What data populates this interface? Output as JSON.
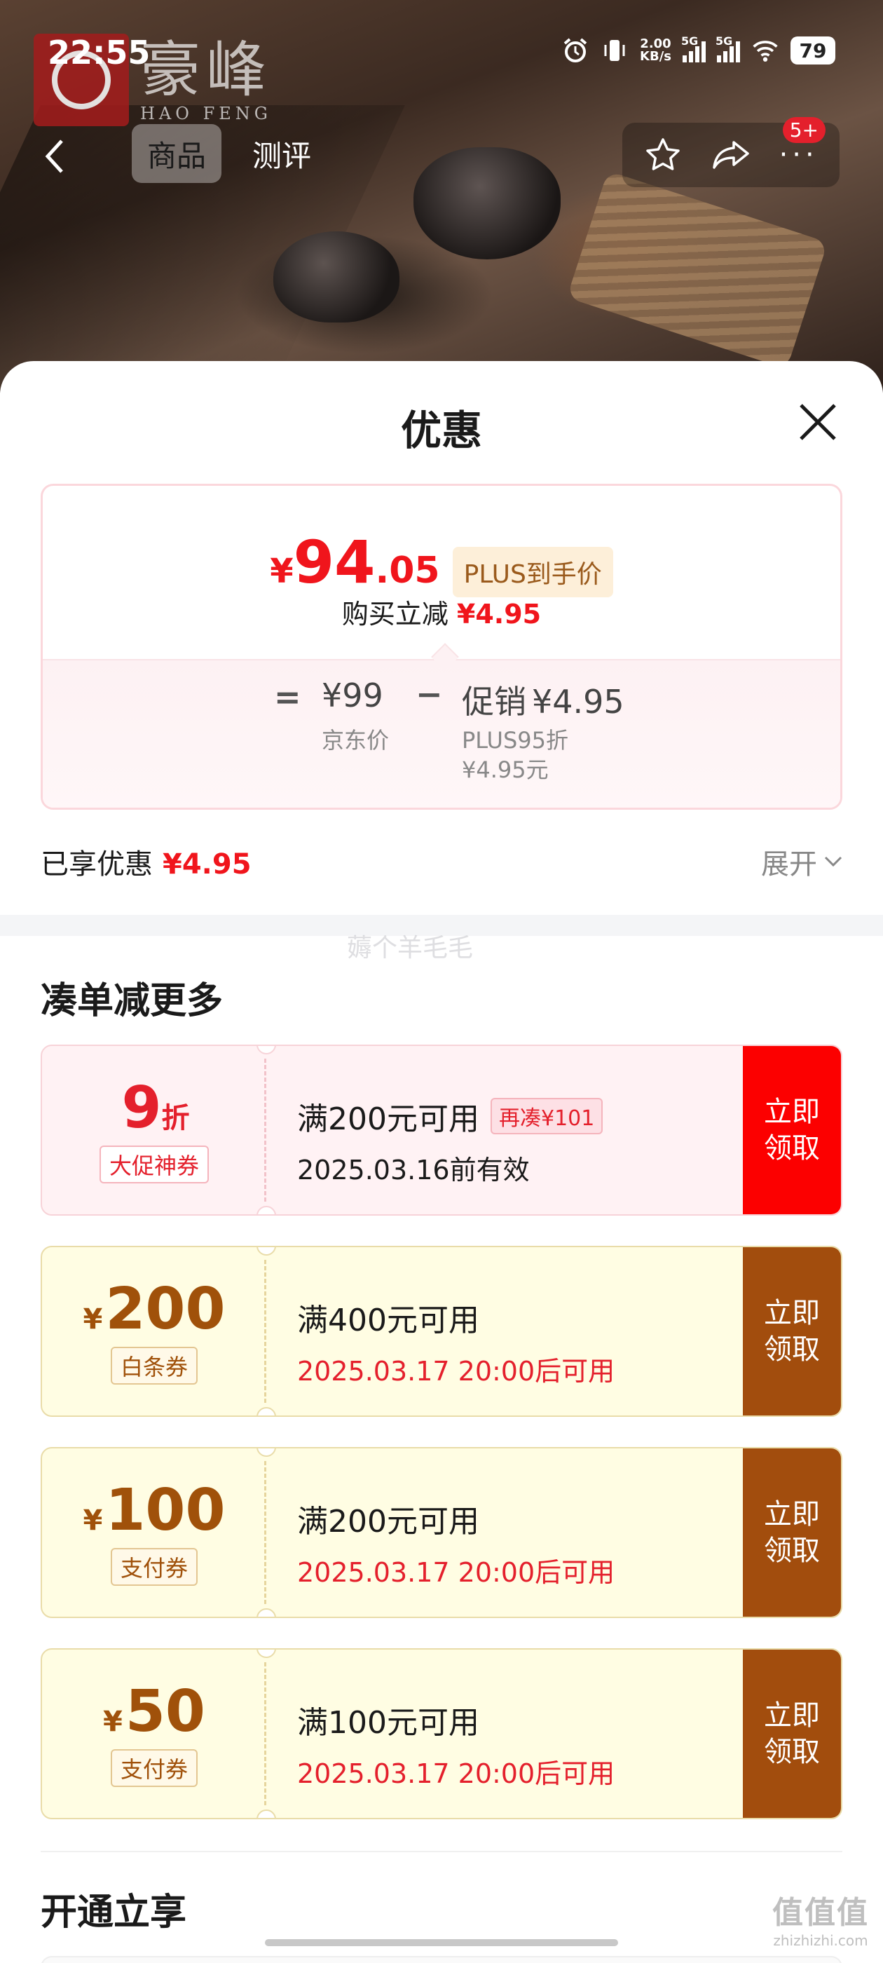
{
  "status_bar": {
    "time": "22:55",
    "net_speed_value": "2.00",
    "net_speed_unit": "KB/s",
    "signal1_tag": "5G",
    "signal2_tag": "5G",
    "battery": "79"
  },
  "brand": {
    "name": "豪峰",
    "pinyin": "HAO FENG"
  },
  "nav": {
    "tabs": [
      {
        "label": "商品",
        "active": true
      },
      {
        "label": "测评",
        "active": false
      }
    ],
    "message_badge": "5+"
  },
  "sheet": {
    "title": "优惠"
  },
  "price_card": {
    "yen": "¥",
    "price_int": "94",
    "price_dec": ".05",
    "plus_tag": "PLUS到手价",
    "reduce_label": "购买立减",
    "reduce_amount": "¥4.95",
    "equals": "=",
    "jd_price": "¥99",
    "jd_price_label": "京东价",
    "minus": "−",
    "promo_label": "促销",
    "promo_value": "¥4.95",
    "promo_sub1": "PLUS95折",
    "promo_sub2": "¥4.95元"
  },
  "enjoyed": {
    "label": "已享优惠",
    "amount": "¥4.95",
    "expand_label": "展开"
  },
  "watermark": "薅个羊毛毛",
  "section_more": {
    "title": "凑单减更多"
  },
  "coupons": [
    {
      "style": "red",
      "yen": "",
      "value": "9",
      "unit": "折",
      "type": "大促神券",
      "condition": "满200元可用",
      "extra": "再凑¥101",
      "date": "2025.03.16前有效",
      "button": "立即领取"
    },
    {
      "style": "gold",
      "yen": "¥",
      "value": "200",
      "unit": "",
      "type": "白条券",
      "condition": "满400元可用",
      "extra": "",
      "date": "2025.03.17 20:00后可用",
      "button": "立即领取"
    },
    {
      "style": "gold",
      "yen": "¥",
      "value": "100",
      "unit": "",
      "type": "支付券",
      "condition": "满200元可用",
      "extra": "",
      "date": "2025.03.17 20:00后可用",
      "button": "立即领取"
    },
    {
      "style": "gold",
      "yen": "¥",
      "value": "50",
      "unit": "",
      "type": "支付券",
      "condition": "满100元可用",
      "extra": "",
      "date": "2025.03.17 20:00后可用",
      "button": "立即领取"
    }
  ],
  "section_open": {
    "title": "开通立享"
  },
  "site_mark": {
    "logo": "值值值",
    "url": "zhizhizhi.com"
  },
  "colors": {
    "accent_red": "#f0151c",
    "coupon_red_button": "#fc0000",
    "coupon_gold_button": "#a24d0d",
    "plus_tag_bg": "#fdefd9"
  }
}
